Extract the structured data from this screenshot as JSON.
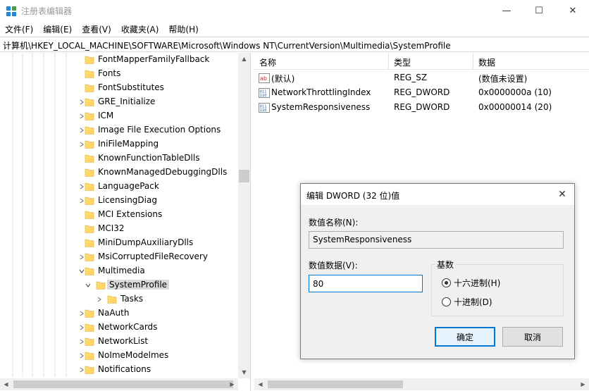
{
  "window": {
    "title": "注册表编辑器",
    "controls": {
      "minimize": "—",
      "maximize": "☐",
      "close": "✕"
    }
  },
  "menu": [
    "文件(F)",
    "编辑(E)",
    "查看(V)",
    "收藏夹(A)",
    "帮助(H)"
  ],
  "address": "计算机\\HKEY_LOCAL_MACHINE\\SOFTWARE\\Microsoft\\Windows NT\\CurrentVersion\\Multimedia\\SystemProfile",
  "tree": {
    "items": [
      {
        "label": "FontMapperFamilyFallback",
        "expander": ""
      },
      {
        "label": "Fonts",
        "expander": ""
      },
      {
        "label": "FontSubstitutes",
        "expander": ""
      },
      {
        "label": "GRE_Initialize",
        "expander": ">"
      },
      {
        "label": "ICM",
        "expander": ">"
      },
      {
        "label": "Image File Execution Options",
        "expander": ">"
      },
      {
        "label": "IniFileMapping",
        "expander": ">"
      },
      {
        "label": "KnownFunctionTableDlls",
        "expander": ""
      },
      {
        "label": "KnownManagedDebuggingDlls",
        "expander": ""
      },
      {
        "label": "LanguagePack",
        "expander": ">"
      },
      {
        "label": "LicensingDiag",
        "expander": ">"
      },
      {
        "label": "MCI Extensions",
        "expander": ""
      },
      {
        "label": "MCI32",
        "expander": ""
      },
      {
        "label": "MiniDumpAuxiliaryDlls",
        "expander": ""
      },
      {
        "label": "MsiCorruptedFileRecovery",
        "expander": ">"
      },
      {
        "label": "Multimedia",
        "expander": "v"
      },
      {
        "label": "SystemProfile",
        "expander": "v"
      },
      {
        "label": "Tasks",
        "expander": ">"
      },
      {
        "label": "NaAuth",
        "expander": ">"
      },
      {
        "label": "NetworkCards",
        "expander": ">"
      },
      {
        "label": "NetworkList",
        "expander": ">"
      },
      {
        "label": "NoImeModelmes",
        "expander": ">"
      },
      {
        "label": "Notifications",
        "expander": ">"
      }
    ]
  },
  "values": {
    "headers": {
      "name": "名称",
      "type": "类型",
      "data": "数据"
    },
    "rows": [
      {
        "name": "(默认)",
        "type": "REG_SZ",
        "data": "(数值未设置)",
        "icon": "string-value-icon"
      },
      {
        "name": "NetworkThrottlingIndex",
        "type": "REG_DWORD",
        "data": "0x0000000a (10)",
        "icon": "binary-value-icon"
      },
      {
        "name": "SystemResponsiveness",
        "type": "REG_DWORD",
        "data": "0x00000014 (20)",
        "icon": "binary-value-icon"
      }
    ]
  },
  "dialog": {
    "title": "编辑 DWORD (32 位)值",
    "close": "✕",
    "name_label": "数值名称(N):",
    "name_value": "SystemResponsiveness",
    "data_label": "数值数据(V):",
    "data_value": "80",
    "base_label": "基数",
    "hex_label": "十六进制(H)",
    "dec_label": "十进制(D)",
    "ok_label": "确定",
    "cancel_label": "取消"
  },
  "colors": {
    "accent": "#0078d7",
    "folder": "#ffd868"
  }
}
